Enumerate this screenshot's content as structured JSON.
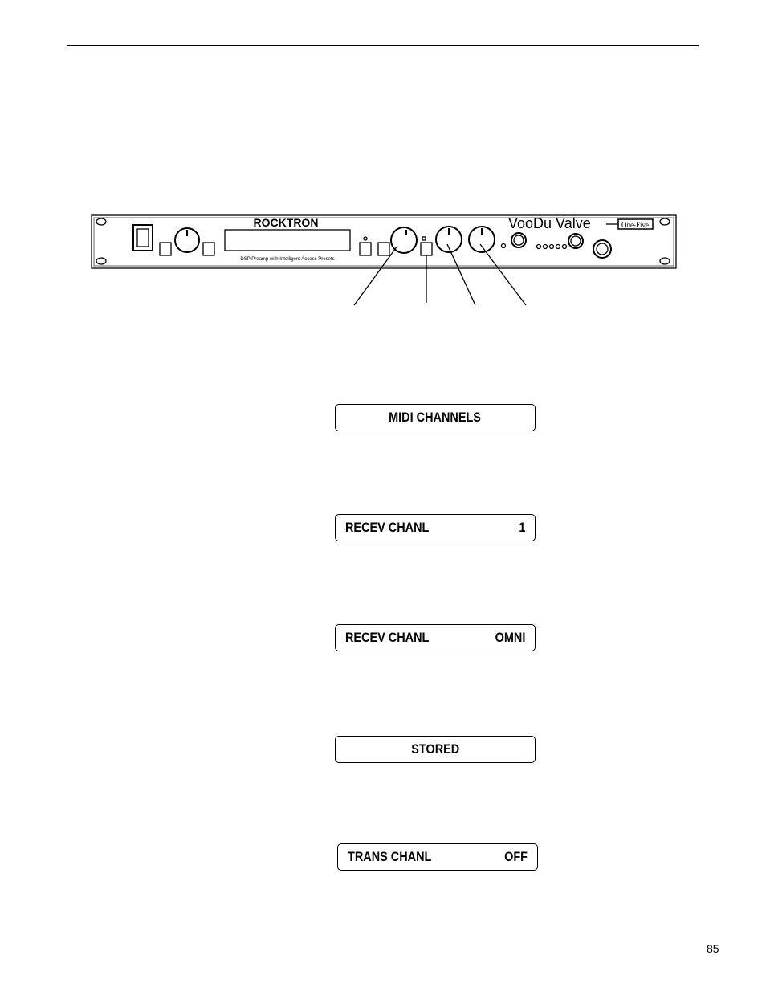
{
  "panel": {
    "brand": "ROCKTRON",
    "subtitle": "DSP Preamp with Intelligent Access Presets",
    "product_logo": "VooDu Valve",
    "badge": "One-Five"
  },
  "displays": [
    {
      "left": "MIDI CHANNELS",
      "right": ""
    },
    {
      "left": "RECEV CHANL",
      "right": "1"
    },
    {
      "left": "RECEV CHANL",
      "right": "OMNI"
    },
    {
      "left": "STORED",
      "right": ""
    },
    {
      "left": "TRANS CHANL",
      "right": "OFF"
    }
  ],
  "page_number": "85"
}
